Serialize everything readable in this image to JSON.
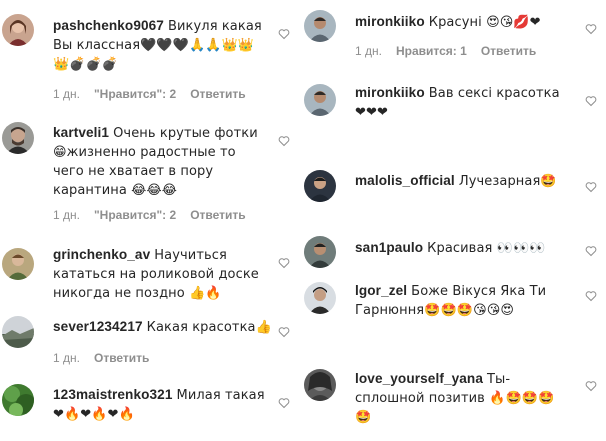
{
  "left": [
    {
      "username": "pashchenko9067",
      "text": "Викуля какая Вы классная🖤🖤🖤🙏🙏👑👑👑💣💣💣",
      "time": "1 дн.",
      "likes": "\"Нравится\": 2",
      "reply": "Ответить"
    },
    {
      "username": "kartveli1",
      "text": "Очень крутые фотки 😁жизненно радостные то чего не хватает в пору карантина 😂😂😂",
      "time": "1 дн.",
      "likes": "\"Нравится\": 2",
      "reply": "Ответить"
    },
    {
      "username": "grinchenko_av",
      "text": "Научиться кататься на роликовой доске никогда не поздно 👍🔥",
      "time": "",
      "likes": "",
      "reply": ""
    },
    {
      "username": "sever1234217",
      "text": "Какая красотка👍",
      "time": "1 дн.",
      "likes": "",
      "reply": "Ответить"
    },
    {
      "username": "123maistrenko321",
      "text": "Милая такая ❤🔥❤🔥❤🔥",
      "time": "",
      "likes": "",
      "reply": ""
    }
  ],
  "right": [
    {
      "username": "mironkiiko",
      "text": "Красуні 😍😘💋❤",
      "time": "1 дн.",
      "likes": "Нравится: 1",
      "reply": "Ответить"
    },
    {
      "username": "mironkiiko",
      "text": "Вав сексі красотка ❤❤❤",
      "time": "",
      "likes": "",
      "reply": ""
    },
    {
      "username": "malolis_official",
      "text": "Лучезарная🤩",
      "time": "",
      "likes": "",
      "reply": ""
    },
    {
      "username": "san1paulo",
      "text": "Красивая 👀👀👀",
      "time": "",
      "likes": "",
      "reply": ""
    },
    {
      "username": "lgor_zel",
      "text": "Боже Вікуся Яка Ти Гарнюння🤩🤩🤩😘😘😍",
      "time": "",
      "likes": "",
      "reply": ""
    },
    {
      "username": "love_yourself_yana",
      "text": "Ты-сплошной позитив 🔥🤩🤩🤩🤩",
      "time": "",
      "likes": "",
      "reply": ""
    }
  ]
}
